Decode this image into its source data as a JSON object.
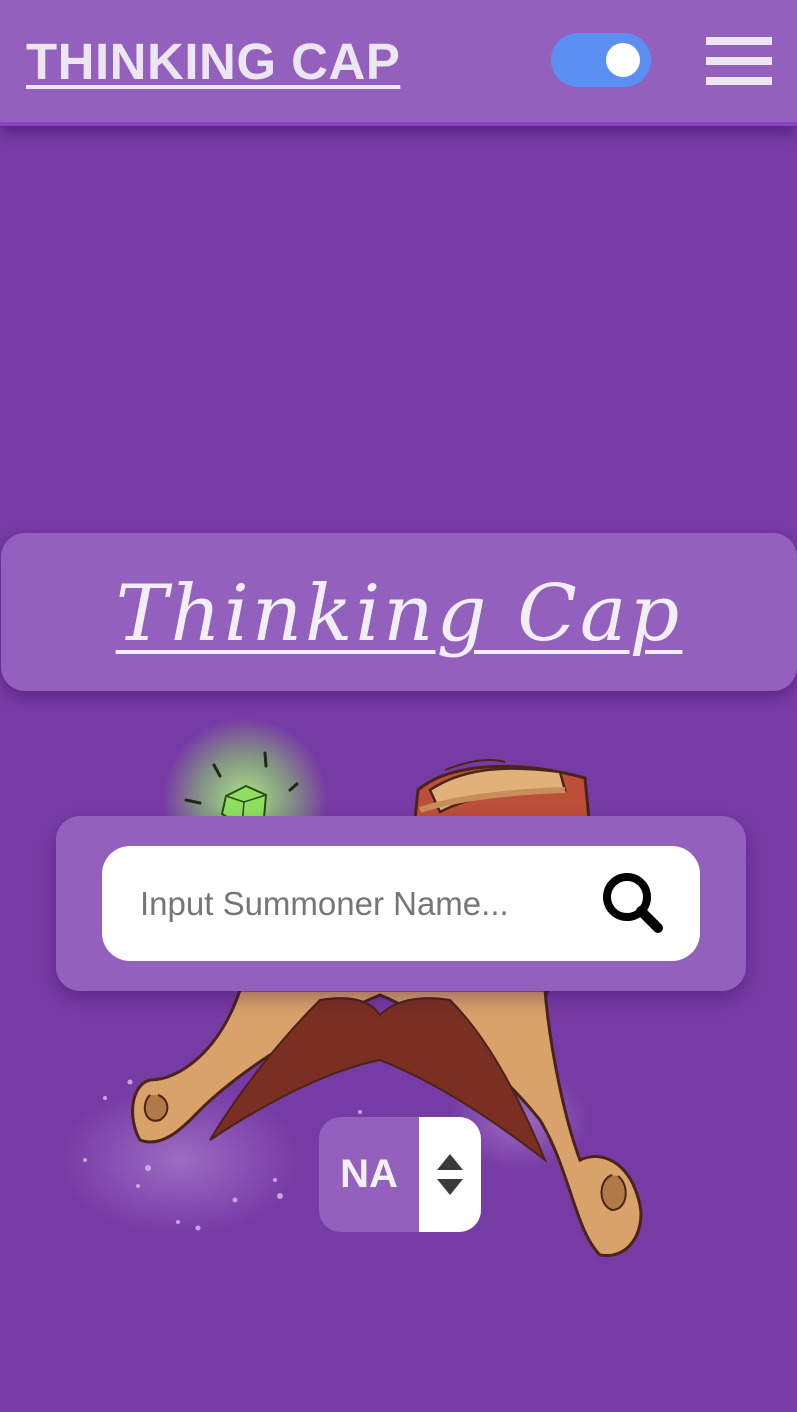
{
  "header": {
    "brand": "THINKING CAP",
    "theme_toggle": {
      "state": "on",
      "color": "#5b8ff2"
    },
    "menu_icon": "hamburger-menu-icon"
  },
  "hero": {
    "title": "Thinking Cap"
  },
  "search": {
    "placeholder": "Input Summoner Name...",
    "value": "",
    "icon": "search-icon"
  },
  "region_select": {
    "selected": "NA",
    "icon": "up-down-arrows-icon"
  },
  "colors": {
    "background": "#773ba5",
    "panel": "#9460be",
    "text_light": "#ece6f2"
  }
}
